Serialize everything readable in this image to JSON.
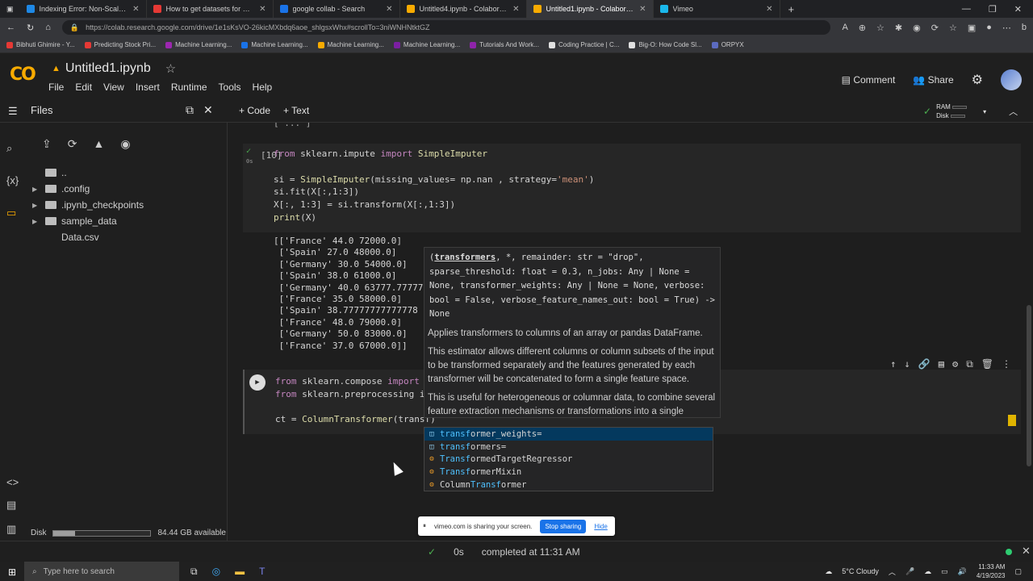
{
  "browser": {
    "tabs": [
      {
        "title": "Indexing Error: Non-Scalar Key",
        "color": "#1e88e5",
        "active": false
      },
      {
        "title": "How to get datasets for Machine",
        "color": "#e53935",
        "active": false
      },
      {
        "title": "google collab - Search",
        "color": "#1a73e8",
        "active": false
      },
      {
        "title": "Untitled4.ipynb - Colaboratory",
        "color": "#f9ab00",
        "active": false
      },
      {
        "title": "Untitled1.ipynb - Colaboratory",
        "color": "#f9ab00",
        "active": true
      },
      {
        "title": "Vimeo",
        "color": "#1ab7ea",
        "active": false
      }
    ],
    "url": "https://colab.research.google.com/drive/1e1sKsVO-26kicMXbdq6aoe_shlgsxWhx#scrollTo=3niWNHNtktGZ",
    "bookmarks": [
      {
        "label": "Bibhuti Ghimire - Y...",
        "color": "#e53935"
      },
      {
        "label": "Predicting Stock Pri...",
        "color": "#e53935"
      },
      {
        "label": "Machine Learning...",
        "color": "#9c27b0"
      },
      {
        "label": "Machine Learning...",
        "color": "#1a73e8"
      },
      {
        "label": "Machine Learning...",
        "color": "#f9ab00"
      },
      {
        "label": "Machine Learning...",
        "color": "#7b1fa2"
      },
      {
        "label": "Tutorials And Work...",
        "color": "#8e24aa"
      },
      {
        "label": "Coding Practice | C...",
        "color": "#e0e0e0"
      },
      {
        "label": "Big-O: How Code Sl...",
        "color": "#e0e0e0"
      },
      {
        "label": "ORPYX",
        "color": "#5c6bc0"
      }
    ]
  },
  "colab": {
    "logo": "CO",
    "notebook_title": "Untitled1.ipynb",
    "star": "☆",
    "menu": [
      "File",
      "Edit",
      "View",
      "Insert",
      "Runtime",
      "Tools",
      "Help"
    ],
    "comment_label": "Comment",
    "share_label": "Share",
    "add_code": "+ Code",
    "add_text": "+ Text",
    "ram_label": "RAM",
    "disk_label": "Disk"
  },
  "files": {
    "title": "Files",
    "tree": [
      {
        "name": "..",
        "indent": 0,
        "caret": false,
        "kind": "upfolder"
      },
      {
        "name": ".config",
        "indent": 0,
        "caret": true,
        "kind": "folder"
      },
      {
        "name": ".ipynb_checkpoints",
        "indent": 0,
        "caret": true,
        "kind": "folder"
      },
      {
        "name": "sample_data",
        "indent": 0,
        "caret": true,
        "kind": "folder"
      },
      {
        "name": "Data.csv",
        "indent": 0,
        "caret": false,
        "kind": "file"
      }
    ],
    "disk_label": "Disk",
    "disk_available": "84.44 GB available",
    "disk_used_fraction": 0.22
  },
  "cell1": {
    "number": "[10]",
    "exec_time": "0s",
    "lines": [
      "from sklearn.impute import SimpleImputer",
      "",
      "si = SimpleImputer(missing_values= np.nan , strategy='mean')",
      "si.fit(X[:,1:3])",
      "X[:, 1:3] = si.transform(X[:,1:3])",
      "print(X)"
    ],
    "output": [
      "[['France' 44.0 72000.0]",
      " ['Spain' 27.0 48000.0]",
      " ['Germany' 30.0 54000.0]",
      " ['Spain' 38.0 61000.0]",
      " ['Germany' 40.0 63777.777777",
      " ['France' 35.0 58000.0]",
      " ['Spain' 38.77777777777778 5",
      " ['France' 48.0 79000.0]",
      " ['Germany' 50.0 83000.0]",
      " ['France' 37.0 67000.0]]"
    ]
  },
  "cell2": {
    "lines": [
      "from sklearn.compose import C",
      "from sklearn.preprocessing im",
      "",
      "ct = ColumnTransformer(transf)"
    ]
  },
  "tooltip": {
    "signature_param": "transformers",
    "signature_rest": ", *, remainder: str = \"drop\", sparse_threshold: float = 0.3, n_jobs: Any | None = None, transformer_weights: Any | None = None, verbose: bool = False, verbose_feature_names_out: bool = True) -> None",
    "doc_paragraphs": [
      "Applies transformers to columns of an array or pandas DataFrame.",
      "This estimator allows different columns or column subsets of the input to be transformed separately and the features generated by each transformer will be concatenated to form a single feature space.",
      "This is useful for heterogeneous or columnar data, to combine several feature extraction mechanisms or transformations into a single transformer."
    ]
  },
  "autocomplete": [
    {
      "match": "transf",
      "rest": "ormer_weights=",
      "icon": "[@]",
      "selected": true
    },
    {
      "match": "transf",
      "rest": "ormers=",
      "icon": "[@]",
      "selected": false
    },
    {
      "match": "Transf",
      "rest": "ormedTargetRegressor",
      "icon": "⚙",
      "selected": false
    },
    {
      "match": "Transf",
      "rest": "ormerMixin",
      "icon": "⚙",
      "selected": false
    },
    {
      "prefix": "Column",
      "match": "Transf",
      "rest": "ormer",
      "icon": "⚙",
      "selected": false
    }
  ],
  "share_bar": {
    "message": "vimeo.com is sharing your screen.",
    "stop": "Stop sharing",
    "hide": "Hide"
  },
  "status": {
    "check": "✓",
    "time": "0s",
    "completed": "completed at 11:31 AM"
  },
  "taskbar": {
    "search_placeholder": "Type here to search",
    "weather": "5°C  Cloudy",
    "time": "11:33 AM",
    "date": "4/19/2023"
  }
}
